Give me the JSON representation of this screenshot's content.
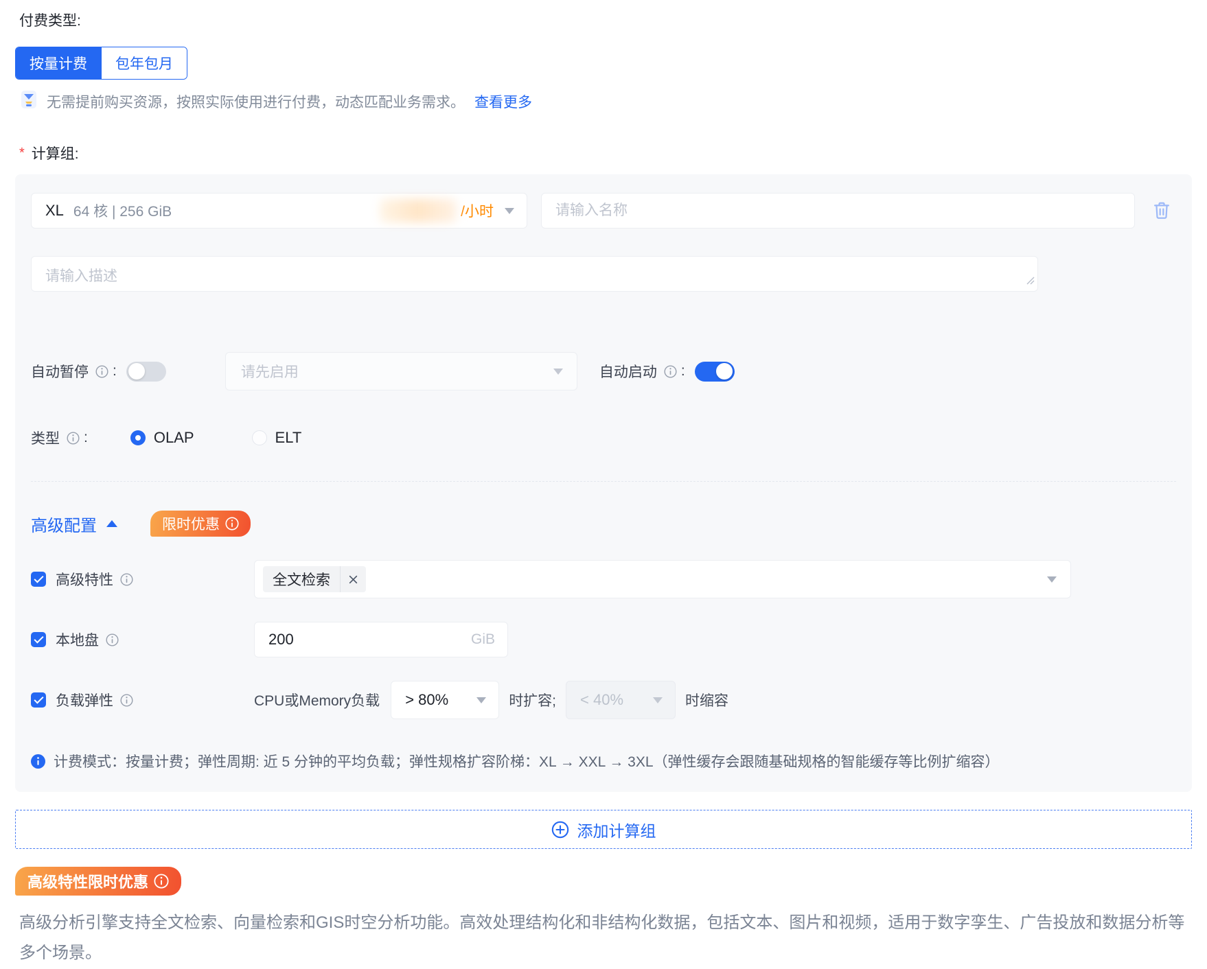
{
  "payment": {
    "label": "付费类型:",
    "tabs": [
      {
        "label": "按量计费",
        "active": true
      },
      {
        "label": "包年包月",
        "active": false
      }
    ],
    "hint": "无需提前购买资源，按照实际使用进行付费，动态匹配业务需求。",
    "hint_link": "查看更多"
  },
  "compute_group": {
    "required_mark": "*",
    "label": "计算组:",
    "spec": {
      "size": "XL",
      "detail": "64 核 | 256 GiB",
      "price_unit": "/小时"
    },
    "name_placeholder": "请输入名称",
    "desc_placeholder": "请输入描述",
    "auto_pause": {
      "label": "自动暂停",
      "colon": ":",
      "enabled": false
    },
    "pause_select_placeholder": "请先启用",
    "auto_start": {
      "label": "自动启动",
      "colon": ":",
      "enabled": true
    },
    "type": {
      "label": "类型",
      "colon": ":",
      "options": [
        {
          "label": "OLAP",
          "selected": true
        },
        {
          "label": "ELT",
          "selected": false
        }
      ]
    },
    "advanced": {
      "title": "高级配置",
      "badge": "限时优惠",
      "features": {
        "label": "高级特性",
        "tag": "全文检索"
      },
      "local_disk": {
        "label": "本地盘",
        "value": "200",
        "unit": "GiB"
      },
      "elastic": {
        "label": "负载弹性",
        "prefix": "CPU或Memory负载",
        "scale_up_value": "> 80%",
        "scale_up_suffix": "时扩容;",
        "scale_down_value": "< 40%",
        "scale_down_suffix": "时缩容"
      }
    },
    "billing_note": "计费模式：按量计费；弹性周期: 近 5 分钟的平均负载；弹性规格扩容阶梯：XL → XXL → 3XL（弹性缓存会跟随基础规格的智能缓存等比例扩缩容）"
  },
  "add_button": {
    "label": "添加计算组"
  },
  "promo": {
    "badge": "高级特性限时优惠",
    "description": "高级分析引擎支持全文检索、向量检索和GIS时空分析功能。高效处理结构化和非结构化数据，包括文本、图片和视频，适用于数字孪生、广告投放和数据分析等多个场景。"
  },
  "colors": {
    "accent": "#2468f2",
    "price_orange": "#ff8a00",
    "badge_gradient_start": "#f9a64a",
    "badge_gradient_end": "#f2512f",
    "danger_asterisk": "#f53f3f",
    "card_background": "#f7f8fa"
  }
}
